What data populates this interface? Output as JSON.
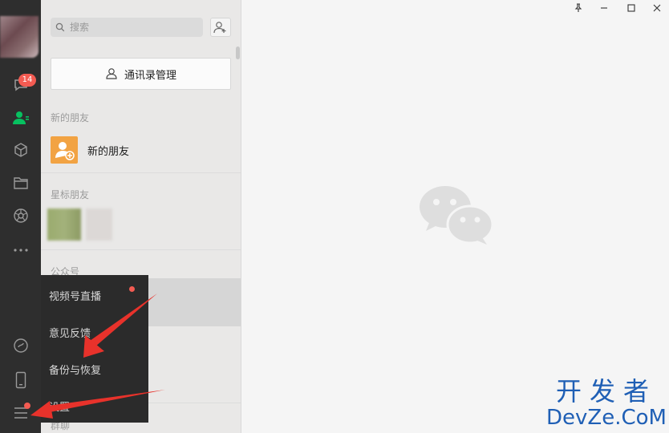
{
  "sidebar": {
    "chat_badge": "14",
    "icons": [
      "chat-icon",
      "contacts-icon",
      "favorites-icon",
      "files-icon",
      "moments-icon",
      "more-icon",
      "mini-program-icon",
      "phone-icon",
      "menu-icon"
    ]
  },
  "contacts_panel": {
    "search_placeholder": "搜索",
    "manage_label": "通讯录管理",
    "section_new_friends": "新的朋友",
    "new_friends_item": "新的朋友",
    "section_starred": "星标朋友",
    "section_official": "公众号",
    "section_groups": "群聊"
  },
  "popup_menu": {
    "items": [
      "视频号直播",
      "意见反馈",
      "备份与恢复",
      "设置"
    ]
  },
  "watermark": {
    "cn": "开发者",
    "en": "DevZe.CoM"
  },
  "colors": {
    "sidebar_bg": "#2e2e2e",
    "accent_green": "#07c160",
    "badge_red": "#f35b52",
    "arrow_red": "#e8322b"
  }
}
